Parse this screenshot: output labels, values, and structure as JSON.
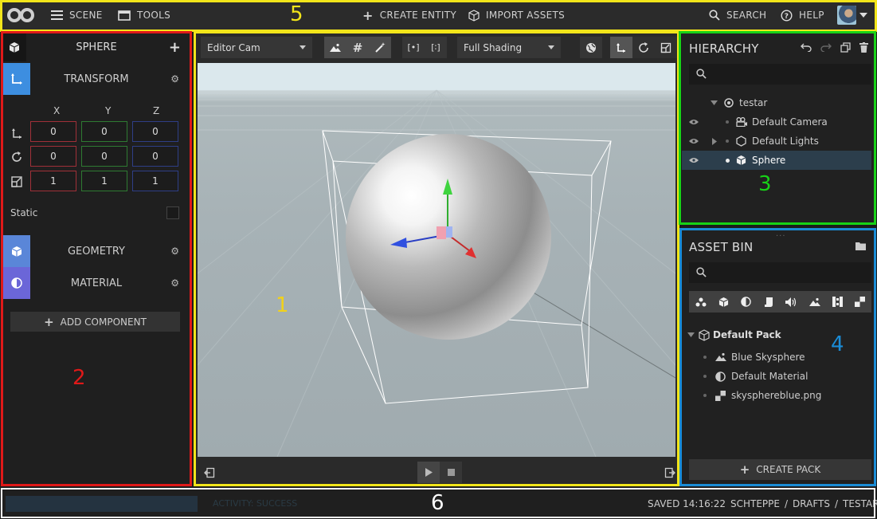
{
  "topbar": {
    "scene_label": "SCENE",
    "tools_label": "TOOLS",
    "create_entity_label": "CREATE ENTITY",
    "import_assets_label": "IMPORT ASSETS",
    "search_label": "SEARCH",
    "help_label": "HELP"
  },
  "inspector": {
    "entity_name": "SPHERE",
    "transform_label": "TRANSFORM",
    "axis_x": "X",
    "axis_y": "Y",
    "axis_z": "Z",
    "translation": [
      "0",
      "0",
      "0"
    ],
    "rotation": [
      "0",
      "0",
      "0"
    ],
    "scale": [
      "1",
      "1",
      "1"
    ],
    "static_label": "Static",
    "geometry_label": "GEOMETRY",
    "material_label": "MATERIAL",
    "add_component_label": "ADD COMPONENT"
  },
  "viewport": {
    "camera_select": "Editor Cam",
    "shading_select": "Full Shading"
  },
  "hierarchy": {
    "title": "HIERARCHY",
    "items": [
      {
        "label": "testar"
      },
      {
        "label": "Default Camera"
      },
      {
        "label": "Default Lights"
      },
      {
        "label": "Sphere"
      }
    ]
  },
  "asset_bin": {
    "title": "ASSET BIN",
    "pack_name": "Default Pack",
    "items": [
      {
        "label": "Blue Skysphere"
      },
      {
        "label": "Default Material"
      },
      {
        "label": "skyspherebluе.png"
      }
    ],
    "create_pack_label": "CREATE PACK"
  },
  "statusbar": {
    "activity": "ACTIVITY: SUCCESS",
    "saved": "SAVED 14:16:22",
    "breadcrumb": [
      "SCHTEPPE",
      "DRAFTS",
      "TESTAR"
    ],
    "separator": "/"
  },
  "annotations": {
    "n1": "1",
    "n2": "2",
    "n3": "3",
    "n4": "4",
    "n5": "5",
    "n6": "6"
  },
  "colors": {
    "anno_yellow": "#f2e51a",
    "anno_red": "#e01919",
    "anno_green": "#17d217",
    "anno_blue": "#1a8cd6",
    "anno_white": "#ffffff",
    "accent_blue": "#3d8ee0",
    "accent_purple": "#6b66d8"
  }
}
